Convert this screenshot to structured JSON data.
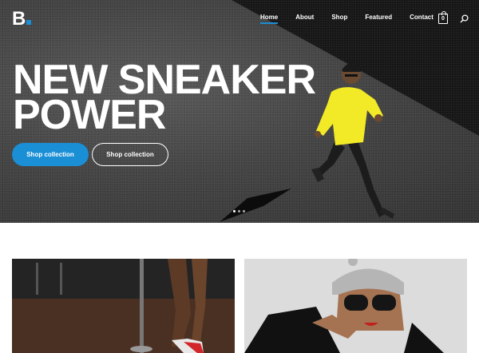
{
  "brand": {
    "logo_text": "B"
  },
  "nav": {
    "items": [
      {
        "label": "Home",
        "active": true
      },
      {
        "label": "About",
        "active": false
      },
      {
        "label": "Shop",
        "active": false
      },
      {
        "label": "Featured",
        "active": false
      },
      {
        "label": "Contact",
        "active": false
      }
    ],
    "cart_count": "0"
  },
  "hero": {
    "headline_line1": "NEW SNEAKER",
    "headline_line2": "POWER",
    "primary_button": "Shop collection",
    "secondary_button": "Shop collection",
    "slides": 3,
    "active_slide": 1
  },
  "colors": {
    "accent": "#1a8fd6",
    "jacket": "#f2ea26"
  }
}
